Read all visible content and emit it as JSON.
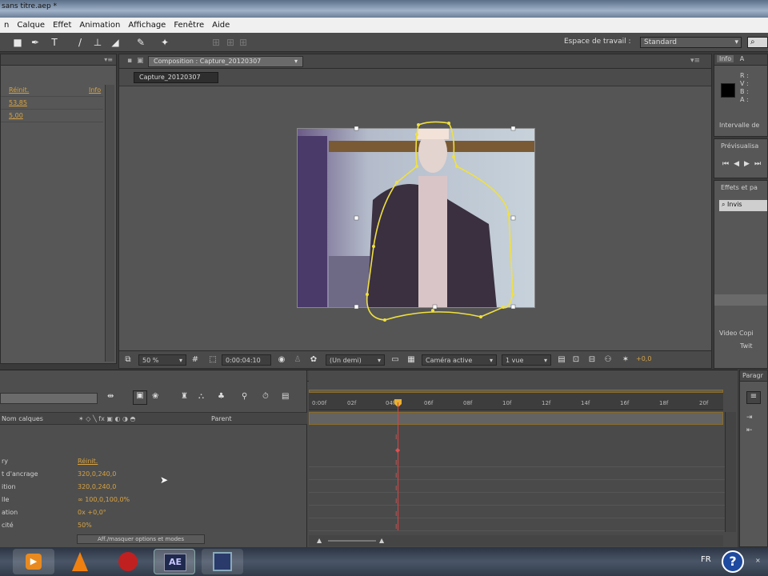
{
  "window": {
    "title": "sans titre.aep *"
  },
  "menu": [
    "n",
    "Calque",
    "Effet",
    "Animation",
    "Affichage",
    "Fenêtre",
    "Aide"
  ],
  "workspace": {
    "label": "Espace de travail :",
    "value": "Standard"
  },
  "left_panel": {
    "reinit": "Réinit.",
    "info": "Info",
    "val1": "53,85",
    "val2": "5,00"
  },
  "composition": {
    "tab": "Composition : Capture_20120307",
    "crumb": "Capture_20120307",
    "zoom": "50 %",
    "timecode": "0:00:04:10",
    "resolution": "(Un demi)",
    "camera": "Caméra active",
    "views": "1 vue",
    "exposure": "+0,0"
  },
  "right_panels": {
    "info_tab": "Info",
    "info_a": "A",
    "r": "R :",
    "v": "V :",
    "b": "B :",
    "a": "A :",
    "interval": "Intervalle de",
    "preview": "Prévisualisa",
    "effects": "Effets et pa",
    "search": "Invis",
    "video_copilot": "Video Copi",
    "twitch": "Twit"
  },
  "timeline": {
    "layer_name_header": "Nom calques",
    "parent_header": "Parent",
    "properties": [
      {
        "name": "ry",
        "value": "Réinit."
      },
      {
        "name": "t d'ancrage",
        "value": "320,0,240,0"
      },
      {
        "name": "ition",
        "value": "320,0,240,0"
      },
      {
        "name": "lle",
        "value": "∞  100,0,100,0%"
      },
      {
        "name": "ation",
        "value": "0x +0,0°"
      },
      {
        "name": "cité",
        "value": "50%"
      }
    ],
    "toggle_button": "Aff./masquer options et modes",
    "ruler": [
      "0:00f",
      "02f",
      "04f",
      "06f",
      "08f",
      "10f",
      "12f",
      "14f",
      "16f",
      "18f",
      "20f"
    ]
  },
  "para_panel": {
    "title": "Paragr"
  },
  "taskbar": {
    "lang": "FR",
    "app_ae": "AE"
  }
}
